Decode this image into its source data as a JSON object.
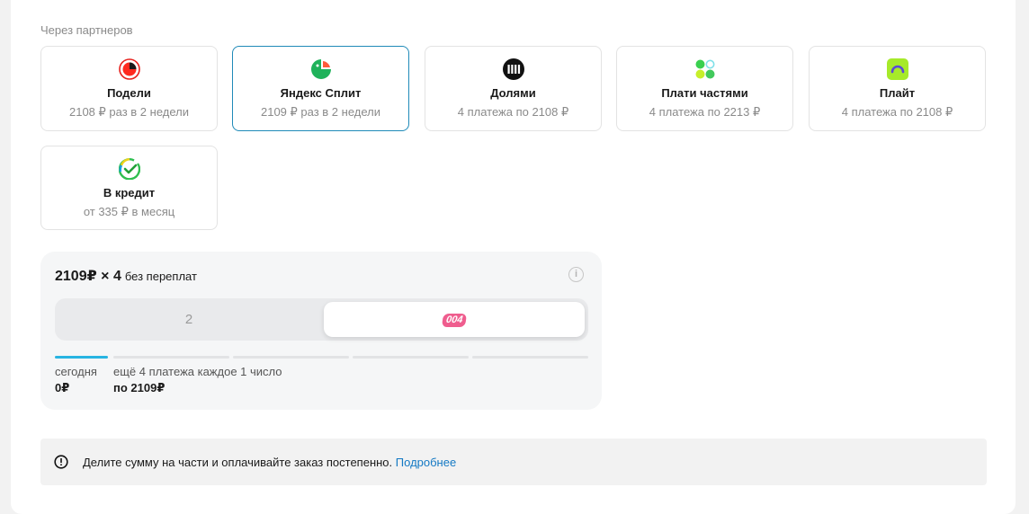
{
  "section_title": "Через партнеров",
  "partners": [
    {
      "name": "Подели",
      "sub": "2108 ₽ раз в 2 недели",
      "icon": "podeli-logo-icon"
    },
    {
      "name": "Яндекс Сплит",
      "sub": "2109 ₽ раз в 2 недели",
      "icon": "yandex-split-logo-icon",
      "selected": true
    },
    {
      "name": "Долями",
      "sub": "4 платежа по 2108 ₽",
      "icon": "dolyami-logo-icon"
    },
    {
      "name": "Плати частями",
      "sub": "4 платежа по 2213 ₽",
      "icon": "plati-chastyami-logo-icon"
    },
    {
      "name": "Плайт",
      "sub": "4 платежа по 2108 ₽",
      "icon": "plait-logo-icon"
    },
    {
      "name": "В кредит",
      "sub": "от 335 ₽ в месяц",
      "icon": "sber-credit-logo-icon"
    }
  ],
  "split": {
    "headline": "2109₽ × 4",
    "headline_note": "без переплат",
    "info_glyph": "i",
    "options": {
      "left": "2",
      "right_badge": "004"
    },
    "progress_filled": 1,
    "progress_total": 5,
    "today_label": "сегодня",
    "today_value": "0₽",
    "next_label": "ещё 4 платежа каждое 1 число",
    "next_value": "по 2109₽"
  },
  "notice": {
    "text": "Делите сумму на части и оплачивайте заказ постепенно.",
    "link": "Подробнее"
  },
  "colors": {
    "accent": "#1f8ab8",
    "progress": "#28b4e2",
    "link": "#1479c4",
    "badge": "#ef5d8e"
  }
}
